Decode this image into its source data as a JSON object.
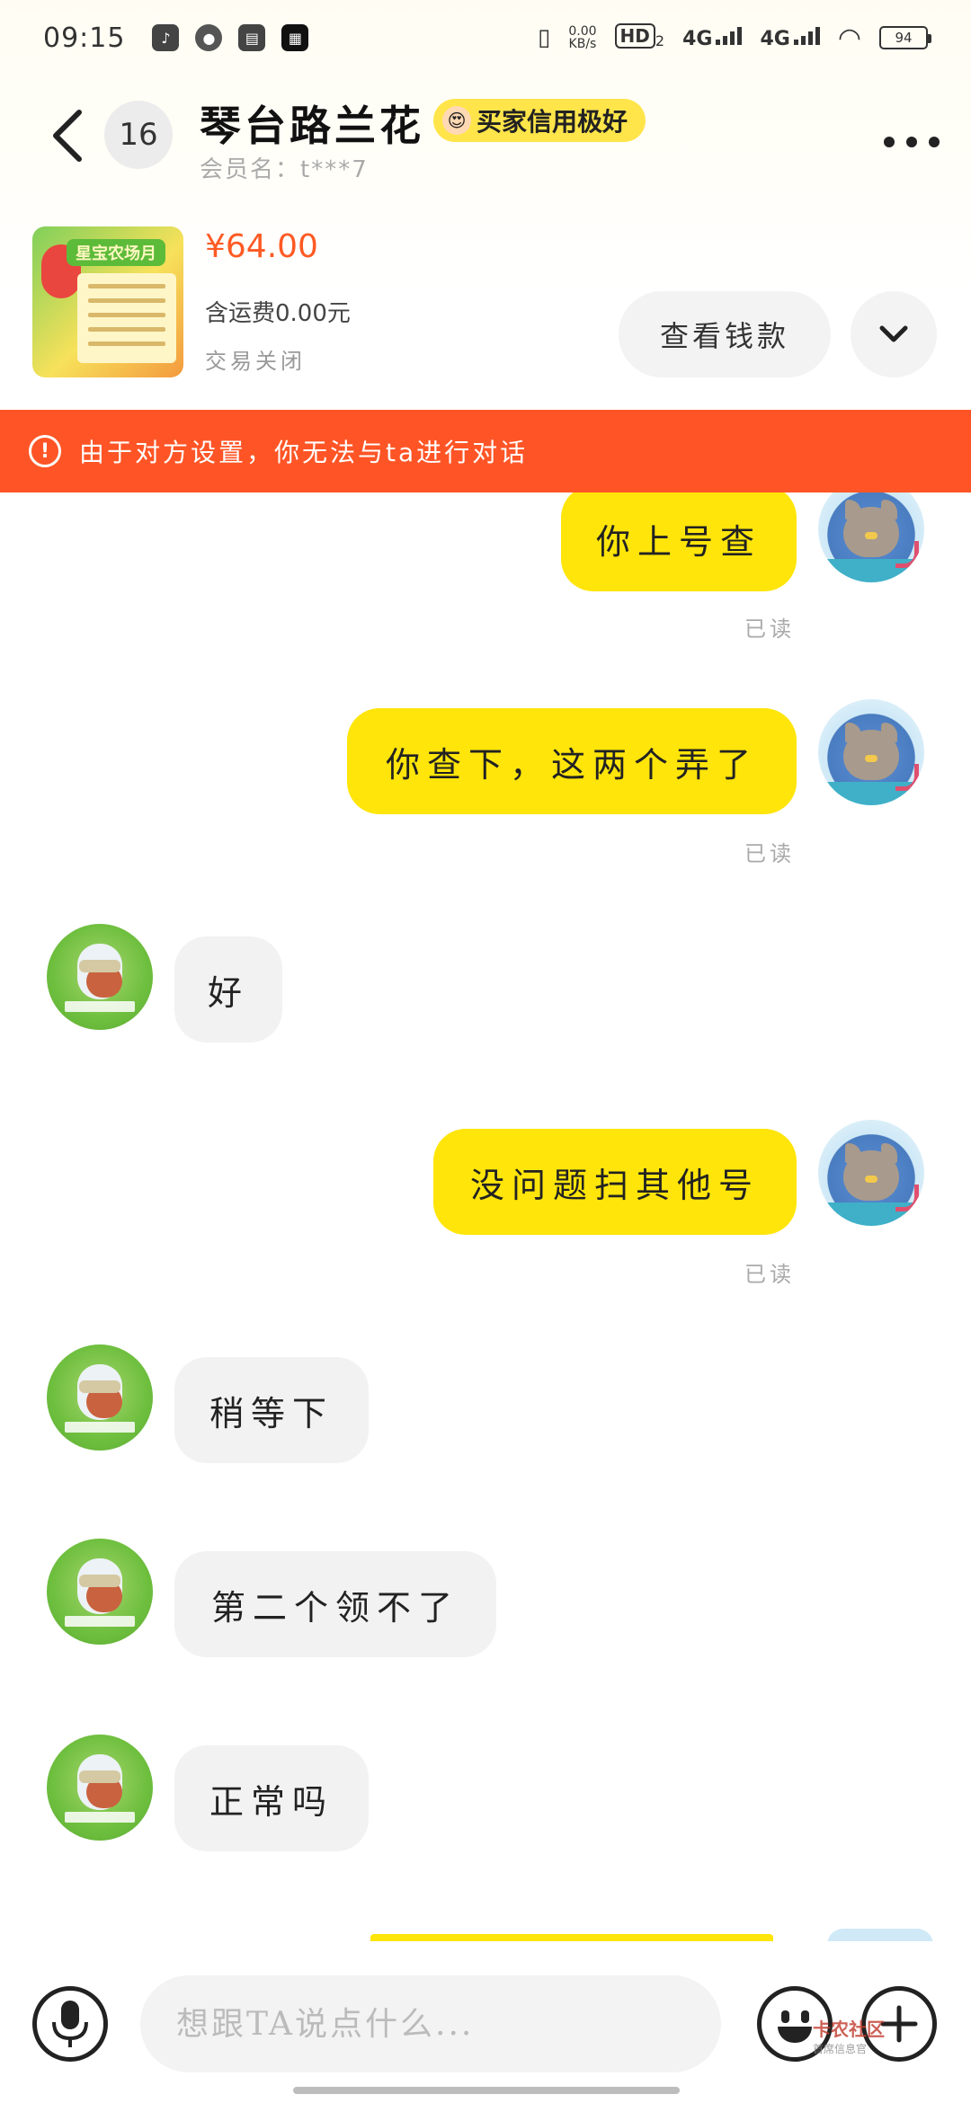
{
  "status_bar": {
    "time": "09:15",
    "apps": [
      "tiktok-icon",
      "wechat-icon",
      "book-icon",
      "news-icon"
    ],
    "speed_value": "0.00",
    "speed_unit": "KB/s",
    "hd": "HD",
    "hd_sub": "2",
    "sig1": "4G",
    "sig2": "4G",
    "battery": "94"
  },
  "header": {
    "unread_count": "16",
    "seller_name": "琴台路兰花",
    "credit_badge": "买家信用极好",
    "member_label": "会员名：t***7"
  },
  "item": {
    "thumb_banner": "星宝农场月",
    "price": "¥64.00",
    "shipping": "含运费0.00元",
    "status": "交易关闭",
    "refund_button": "查看钱款"
  },
  "alert": {
    "text": "由于对方设置，你无法与ta进行对话"
  },
  "messages": [
    {
      "side": "mine",
      "text": "你上号查",
      "read": "已读"
    },
    {
      "side": "mine",
      "text": "你查下，这两个弄了",
      "read": "已读"
    },
    {
      "side": "theirs",
      "text": "好"
    },
    {
      "side": "mine",
      "text": "没问题扫其他号",
      "read": "已读"
    },
    {
      "side": "theirs",
      "text": "稍等下"
    },
    {
      "side": "theirs",
      "text": "第二个领不了"
    },
    {
      "side": "theirs",
      "text": "正常吗"
    }
  ],
  "input": {
    "placeholder": "想跟TA说点什么..."
  },
  "watermark": {
    "title": "卡农社区",
    "sub": "首席信息官"
  },
  "colors": {
    "accent_yellow": "#ffe50a",
    "alert_orange": "#ff5526",
    "price_red": "#ff5a24",
    "bubble_grey": "#f2f2f2"
  }
}
